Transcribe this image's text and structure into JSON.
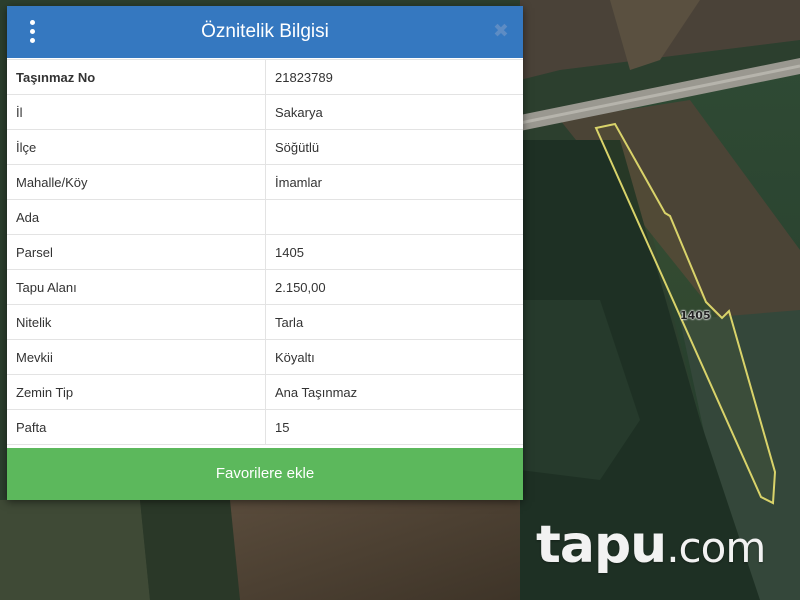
{
  "panel": {
    "title": "Öznitelik Bilgisi",
    "menu_icon": "vertical-dots-icon",
    "close_icon": "close-icon",
    "close_glyph": "✖",
    "rows": [
      {
        "key": "Taşınmaz No",
        "value": "21823789"
      },
      {
        "key": "İl",
        "value": "Sakarya"
      },
      {
        "key": "İlçe",
        "value": "Söğütlü"
      },
      {
        "key": "Mahalle/Köy",
        "value": "İmamlar"
      },
      {
        "key": "Ada",
        "value": ""
      },
      {
        "key": "Parsel",
        "value": "1405"
      },
      {
        "key": "Tapu Alanı",
        "value": "2.150,00"
      },
      {
        "key": "Nitelik",
        "value": "Tarla"
      },
      {
        "key": "Mevkii",
        "value": "Köyaltı"
      },
      {
        "key": "Zemin Tip",
        "value": "Ana Taşınmaz"
      },
      {
        "key": "Pafta",
        "value": "15"
      }
    ],
    "favorite_label": "Favorilere ekle"
  },
  "map": {
    "parcel_label": "1405",
    "parcel_outline_color": "#d9d36a"
  },
  "logo": {
    "main": "tapu",
    "domain": ".com"
  },
  "colors": {
    "header": "#3578c0",
    "favorite_button": "#5cb85c"
  }
}
